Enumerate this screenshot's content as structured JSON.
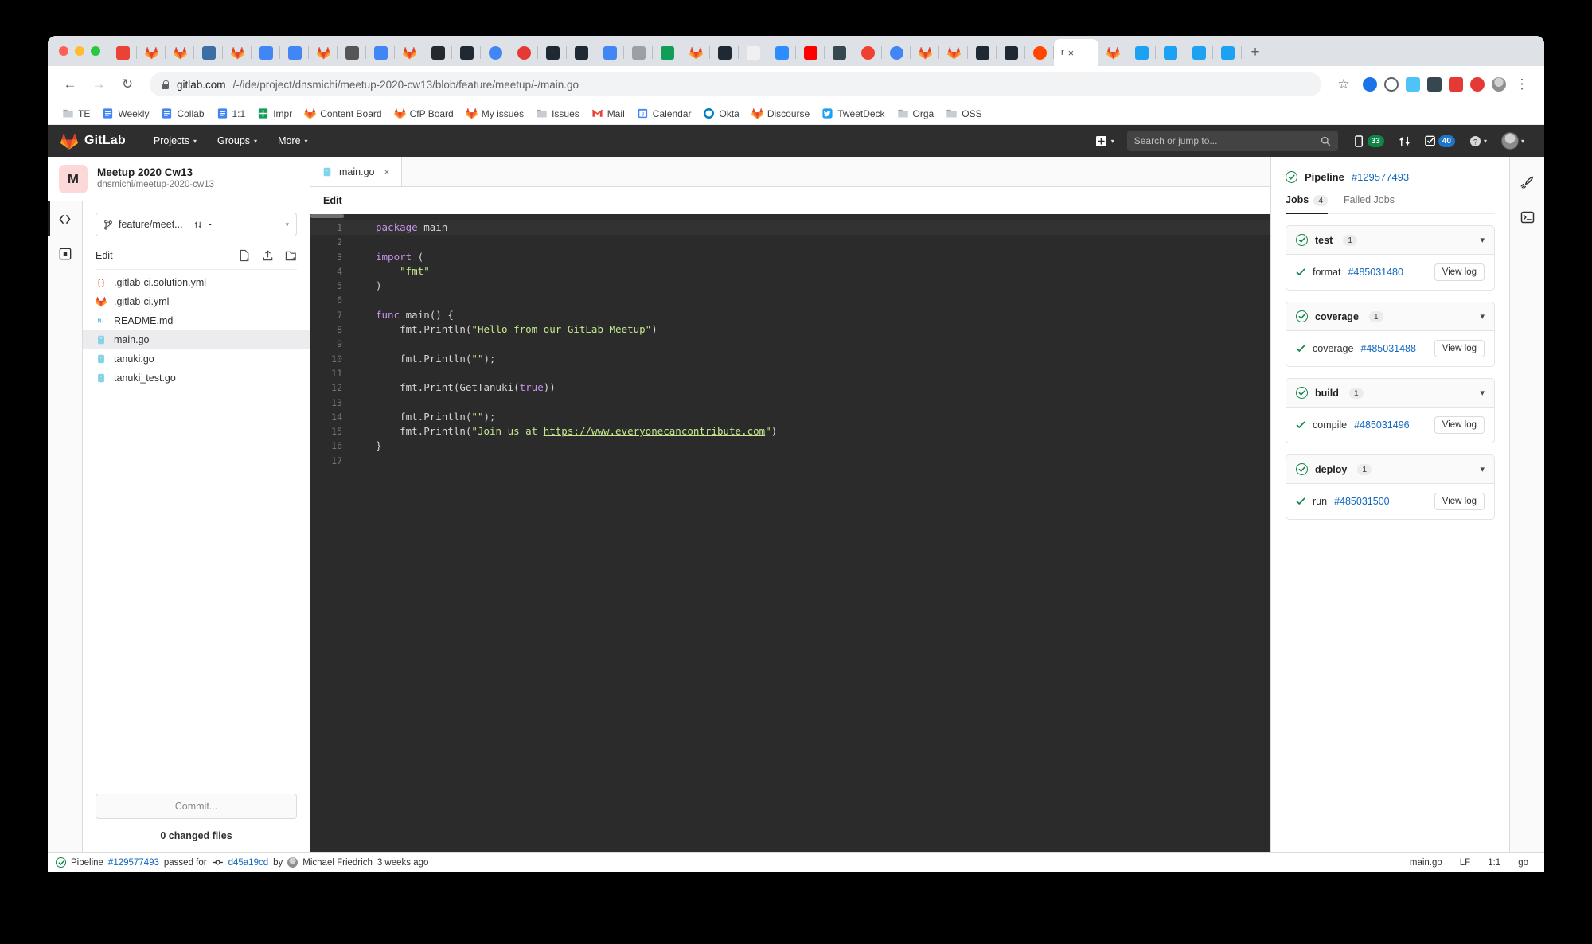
{
  "browser": {
    "tabs_note": "many pinned favicon-only tabs",
    "active_tab_label": "r",
    "active_tab_close": "×",
    "new_tab": "+",
    "nav": {
      "back": "←",
      "forward": "→",
      "reload": "↻",
      "star": "☆",
      "menu": "⋮"
    },
    "url": {
      "host": "gitlab.com",
      "path": "/-/ide/project/dnsmichi/meetup-2020-cw13/blob/feature/meetup/-/main.go"
    },
    "bookmarks": [
      {
        "label": "TE",
        "icon": "folder-icon",
        "color": "#9aa0a6"
      },
      {
        "label": "Weekly",
        "icon": "doc-icon",
        "color": "#4285f4"
      },
      {
        "label": "Collab",
        "icon": "doc-icon",
        "color": "#4285f4"
      },
      {
        "label": "1:1",
        "icon": "doc-icon",
        "color": "#4285f4"
      },
      {
        "label": "Impr",
        "icon": "sheets-icon",
        "color": "#0f9d58"
      },
      {
        "label": "Content Board",
        "icon": "gitlab-icon",
        "color": "#fc6d26"
      },
      {
        "label": "CfP Board",
        "icon": "gitlab-icon",
        "color": "#fc6d26"
      },
      {
        "label": "My issues",
        "icon": "gitlab-icon",
        "color": "#fc6d26"
      },
      {
        "label": "Issues",
        "icon": "folder-icon",
        "color": "#9aa0a6"
      },
      {
        "label": "Mail",
        "icon": "gmail-icon",
        "color": "#ea4335"
      },
      {
        "label": "Calendar",
        "icon": "calendar-icon",
        "color": "#4285f4"
      },
      {
        "label": "Okta",
        "icon": "okta-icon",
        "color": "#007dc1"
      },
      {
        "label": "Discourse",
        "icon": "gitlab-icon",
        "color": "#fc6d26"
      },
      {
        "label": "TweetDeck",
        "icon": "twitter-icon",
        "color": "#1da1f2"
      },
      {
        "label": "Orga",
        "icon": "folder-icon",
        "color": "#9aa0a6"
      },
      {
        "label": "OSS",
        "icon": "folder-icon",
        "color": "#9aa0a6"
      }
    ]
  },
  "gitlab_nav": {
    "brand": "GitLab",
    "menu": [
      {
        "label": "Projects",
        "caret": "▾"
      },
      {
        "label": "Groups",
        "caret": "▾"
      },
      {
        "label": "More",
        "caret": "▾"
      }
    ],
    "plus_caret": "▾",
    "search_placeholder": "Search or jump to...",
    "issues_count": "33",
    "todos_count": "40",
    "help_caret": "▾",
    "user_caret": "▾"
  },
  "project": {
    "initial": "M",
    "name": "Meetup 2020 Cw13",
    "path": "dnsmichi/meetup-2020-cw13"
  },
  "sidebar": {
    "branch": "feature/meet...",
    "mr_value": "-",
    "branch_caret": "▾",
    "section_label": "Edit",
    "files": [
      {
        "name": ".gitlab-ci.solution.yml",
        "icon": "yaml-icon",
        "selected": false
      },
      {
        "name": ".gitlab-ci.yml",
        "icon": "gitlab-icon",
        "selected": false
      },
      {
        "name": "README.md",
        "icon": "markdown-icon",
        "selected": false
      },
      {
        "name": "main.go",
        "icon": "go-icon",
        "selected": true
      },
      {
        "name": "tanuki.go",
        "icon": "go-icon",
        "selected": false
      },
      {
        "name": "tanuki_test.go",
        "icon": "go-icon",
        "selected": false
      }
    ],
    "commit_button": "Commit...",
    "changed_files": "0 changed files"
  },
  "editor": {
    "tab_label": "main.go",
    "tab_close": "×",
    "mode_label": "Edit",
    "lines": [
      {
        "n": "1",
        "tokens": [
          {
            "t": "package ",
            "c": "kw"
          },
          {
            "t": "main",
            "c": "id"
          }
        ],
        "current": true
      },
      {
        "n": "2",
        "tokens": []
      },
      {
        "n": "3",
        "tokens": [
          {
            "t": "import",
            "c": "kw"
          },
          {
            "t": " (",
            "c": "plain"
          }
        ]
      },
      {
        "n": "4",
        "tokens": [
          {
            "t": "    ",
            "c": "plain"
          },
          {
            "t": "\"fmt\"",
            "c": "str"
          }
        ]
      },
      {
        "n": "5",
        "tokens": [
          {
            "t": ")",
            "c": "plain"
          }
        ]
      },
      {
        "n": "6",
        "tokens": []
      },
      {
        "n": "7",
        "tokens": [
          {
            "t": "func ",
            "c": "kw"
          },
          {
            "t": "main() {",
            "c": "id"
          }
        ]
      },
      {
        "n": "8",
        "tokens": [
          {
            "t": "    fmt.Println(",
            "c": "plain"
          },
          {
            "t": "\"Hello from our GitLab Meetup\"",
            "c": "str"
          },
          {
            "t": ")",
            "c": "plain"
          }
        ]
      },
      {
        "n": "9",
        "tokens": []
      },
      {
        "n": "10",
        "tokens": [
          {
            "t": "    fmt.Println(",
            "c": "plain"
          },
          {
            "t": "\"\"",
            "c": "str"
          },
          {
            "t": ");",
            "c": "plain"
          }
        ]
      },
      {
        "n": "11",
        "tokens": []
      },
      {
        "n": "12",
        "tokens": [
          {
            "t": "    fmt.Print(GetTanuki(",
            "c": "plain"
          },
          {
            "t": "true",
            "c": "kw"
          },
          {
            "t": "))",
            "c": "plain"
          }
        ]
      },
      {
        "n": "13",
        "tokens": []
      },
      {
        "n": "14",
        "tokens": [
          {
            "t": "    fmt.Println(",
            "c": "plain"
          },
          {
            "t": "\"\"",
            "c": "str"
          },
          {
            "t": ");",
            "c": "plain"
          }
        ]
      },
      {
        "n": "15",
        "tokens": [
          {
            "t": "    fmt.Println(",
            "c": "plain"
          },
          {
            "t": "\"Join us at ",
            "c": "str"
          },
          {
            "t": "https://www.everyonecancontribute.com",
            "c": "lnk"
          },
          {
            "t": "\"",
            "c": "str"
          },
          {
            "t": ")",
            "c": "plain"
          }
        ]
      },
      {
        "n": "16",
        "tokens": [
          {
            "t": "}",
            "c": "plain"
          }
        ]
      },
      {
        "n": "17",
        "tokens": []
      }
    ]
  },
  "pipeline_panel": {
    "title": "Pipeline",
    "id": "#129577493",
    "tabs": [
      {
        "label": "Jobs",
        "count": "4",
        "active": true
      },
      {
        "label": "Failed Jobs",
        "count": null,
        "active": false
      }
    ],
    "stage_chevron": "▾",
    "stages": [
      {
        "name": "test",
        "count": "1",
        "jobs": [
          {
            "name": "format",
            "id": "#485031480",
            "action": "View log"
          }
        ]
      },
      {
        "name": "coverage",
        "count": "1",
        "jobs": [
          {
            "name": "coverage",
            "id": "#485031488",
            "action": "View log"
          }
        ]
      },
      {
        "name": "build",
        "count": "1",
        "jobs": [
          {
            "name": "compile",
            "id": "#485031496",
            "action": "View log"
          }
        ]
      },
      {
        "name": "deploy",
        "count": "1",
        "jobs": [
          {
            "name": "run",
            "id": "#485031500",
            "action": "View log"
          }
        ]
      }
    ]
  },
  "statusbar": {
    "pipeline_word": "Pipeline",
    "pipeline_id": "#129577493",
    "passed_for": "passed for",
    "commit_sha": "d45a19cd",
    "by": "by",
    "author": "Michael Friedrich",
    "time": "3 weeks ago",
    "right": [
      "main.go",
      "LF",
      "1:1",
      "go"
    ]
  },
  "colors": {
    "gitlab_orange": "#fc6d26",
    "success_green": "#108548",
    "link_blue": "#1068bf",
    "nav_dark": "#2e2e2e",
    "editor_bg": "#2b2b2b"
  }
}
